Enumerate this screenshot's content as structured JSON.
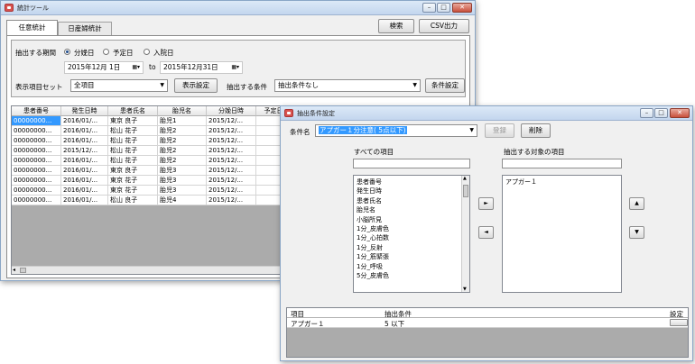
{
  "main_window": {
    "title": "統計ツール",
    "tabs": [
      {
        "label": "任意統計"
      },
      {
        "label": "日産婦統計"
      }
    ],
    "search_button": "検索",
    "csv_button": "CSV出力",
    "period_label": "抽出する期間",
    "radios": [
      {
        "label": "分娩日",
        "selected": true
      },
      {
        "label": "予定日",
        "selected": false
      },
      {
        "label": "入院日",
        "selected": false
      }
    ],
    "date_from": "2015年12月 1日",
    "date_to_label": "to",
    "date_to": "2015年12月31日",
    "item_set_label": "表示項目セット",
    "item_set_value": "全項目",
    "display_settings_button": "表示設定",
    "condition_label": "抽出する条件",
    "condition_value": "抽出条件なし",
    "condition_settings_button": "条件設定",
    "grid_headers": [
      "患者番号",
      "発生日時",
      "患者氏名",
      "胎児名",
      "分娩日時",
      "予定日"
    ],
    "grid_rows": [
      [
        "00000000...",
        "2016/01/...",
        "東京 良子",
        "胎児1",
        "2015/12/...",
        ""
      ],
      [
        "00000000...",
        "2016/01/...",
        "松山 花子",
        "胎児2",
        "2015/12/...",
        ""
      ],
      [
        "00000000...",
        "2016/01/...",
        "松山 花子",
        "胎児2",
        "2015/12/...",
        ""
      ],
      [
        "00000000...",
        "2015/12/...",
        "松山 花子",
        "胎児2",
        "2015/12/...",
        ""
      ],
      [
        "00000000...",
        "2016/01/...",
        "松山 花子",
        "胎児2",
        "2015/12/...",
        ""
      ],
      [
        "00000000...",
        "2016/01/...",
        "東京 良子",
        "胎児3",
        "2015/12/...",
        ""
      ],
      [
        "00000000...",
        "2016/01/...",
        "東京 花子",
        "胎児3",
        "2015/12/...",
        ""
      ],
      [
        "00000000...",
        "2016/01/...",
        "東京 花子",
        "胎児3",
        "2015/12/...",
        ""
      ],
      [
        "00000000...",
        "2016/01/...",
        "松山 良子",
        "胎児4",
        "2015/12/...",
        ""
      ]
    ]
  },
  "dialog": {
    "title": "抽出条件設定",
    "condition_name_label": "条件名",
    "condition_name_value": "アプガー１分注意( 5点以下)",
    "register_button": "登録",
    "delete_button": "削除",
    "all_items_label": "すべての項目",
    "target_items_label": "抽出する対象の項目",
    "all_items": [
      "患者番号",
      "発生日時",
      "患者氏名",
      "胎児名",
      "小脳所見",
      "1分_皮膚色",
      "1分_心拍数",
      "1分_反射",
      "1分_筋緊張",
      "1分_呼吸",
      "5分_皮膚色"
    ],
    "target_items": [
      "アプガー１"
    ],
    "move_right": "►",
    "move_left": "◄",
    "move_up": "▲",
    "move_down": "▼",
    "bottom_headers": {
      "item": "項目",
      "condition": "抽出条件",
      "setting": "設定"
    },
    "bottom_rows": [
      {
        "item": "アプガー１",
        "condition": "5 以下"
      }
    ]
  }
}
